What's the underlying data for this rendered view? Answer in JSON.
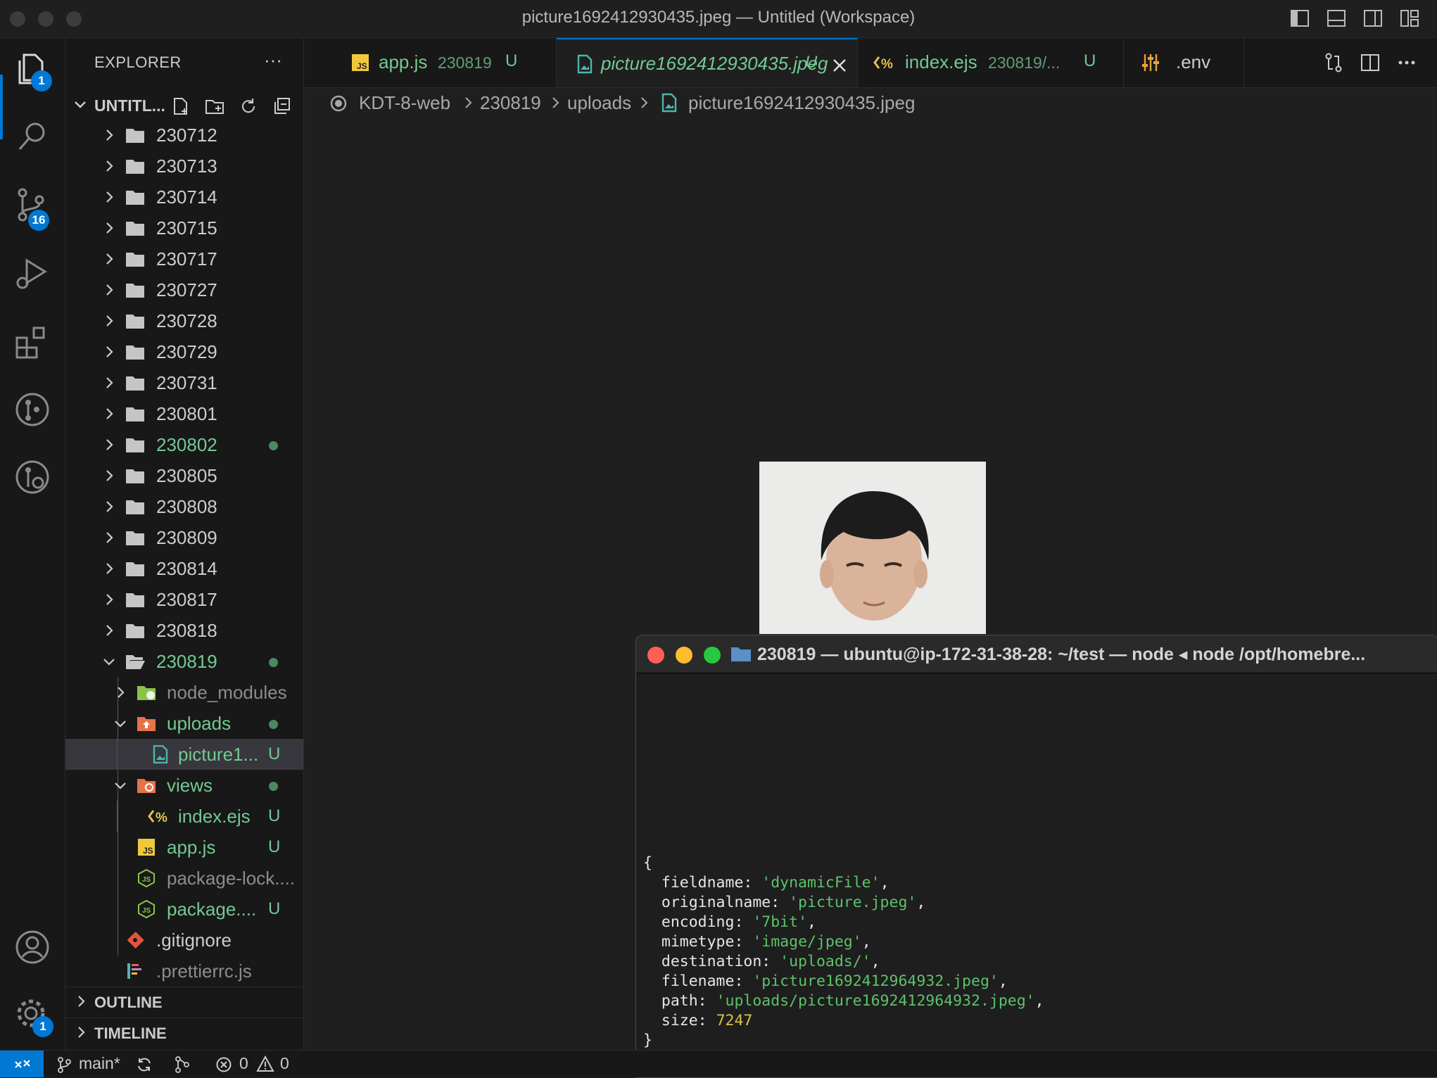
{
  "window": {
    "title": "picture1692412930435.jpeg — Untitled (Workspace)"
  },
  "activity_bar": {
    "explorer_badge": "1",
    "scm_badge": "16",
    "settings_badge": "1"
  },
  "explorer": {
    "header": "EXPLORER",
    "more": "···",
    "workspace_title": "UNTITL...",
    "folders": [
      {
        "label": "230712"
      },
      {
        "label": "230713"
      },
      {
        "label": "230714"
      },
      {
        "label": "230715"
      },
      {
        "label": "230717"
      },
      {
        "label": "230727"
      },
      {
        "label": "230728"
      },
      {
        "label": "230729"
      },
      {
        "label": "230731"
      },
      {
        "label": "230801"
      },
      {
        "label": "230802"
      },
      {
        "label": "230805"
      },
      {
        "label": "230808"
      },
      {
        "label": "230809"
      },
      {
        "label": "230814"
      },
      {
        "label": "230817"
      },
      {
        "label": "230818"
      },
      {
        "label": "230819"
      }
    ],
    "children_230819": {
      "node_modules": "node_modules",
      "uploads": "uploads",
      "picture": "picture1...",
      "views": "views",
      "index_ejs": "index.ejs",
      "app_js": "app.js",
      "package_lock": "package-lock....",
      "package_json": "package....",
      "gitignore": ".gitignore",
      "prettierrc": ".prettierrc.js"
    },
    "untracked_mark": "U",
    "outline": "OUTLINE",
    "timeline": "TIMELINE"
  },
  "tabs": [
    {
      "name": "app.js",
      "desc": "230819",
      "status": "U"
    },
    {
      "name": "picture1692412930435.jpeg",
      "status": "U"
    },
    {
      "name": "index.ejs",
      "desc": "230819/...",
      "status": "U"
    },
    {
      "name": ".env"
    }
  ],
  "breadcrumb": [
    "KDT-8-web",
    "230819",
    "uploads",
    "picture1692412930435.jpeg"
  ],
  "terminal": {
    "title": "230819 — ubuntu@ip-172-31-38-28: ~/test — node ◂ node /opt/homebre...",
    "lines": {
      "open": "{",
      "fieldname_key": "  fieldname: ",
      "fieldname_val": "'dynamicFile'",
      "originalname_key": "  originalname: ",
      "originalname_val": "'picture.jpeg'",
      "encoding_key": "  encoding: ",
      "encoding_val": "'7bit'",
      "mimetype_key": "  mimetype: ",
      "mimetype_val": "'image/jpeg'",
      "destination_key": "  destination: ",
      "destination_val": "'uploads/'",
      "filename_key": "  filename: ",
      "filename_val": "'picture1692412964932.jpeg'",
      "path_key": "  path: ",
      "path_val": "'uploads/picture1692412964932.jpeg'",
      "size_key": "  size: ",
      "size_val": "7247",
      "close": "}"
    },
    "comma": ","
  },
  "status_bar": {
    "branch": "main*",
    "errors": "0",
    "warnings": "0"
  },
  "colors": {
    "accent": "#0078d4",
    "git_untracked": "#73c991",
    "terminal_string": "#5cc36a",
    "terminal_number": "#d7c44a"
  }
}
